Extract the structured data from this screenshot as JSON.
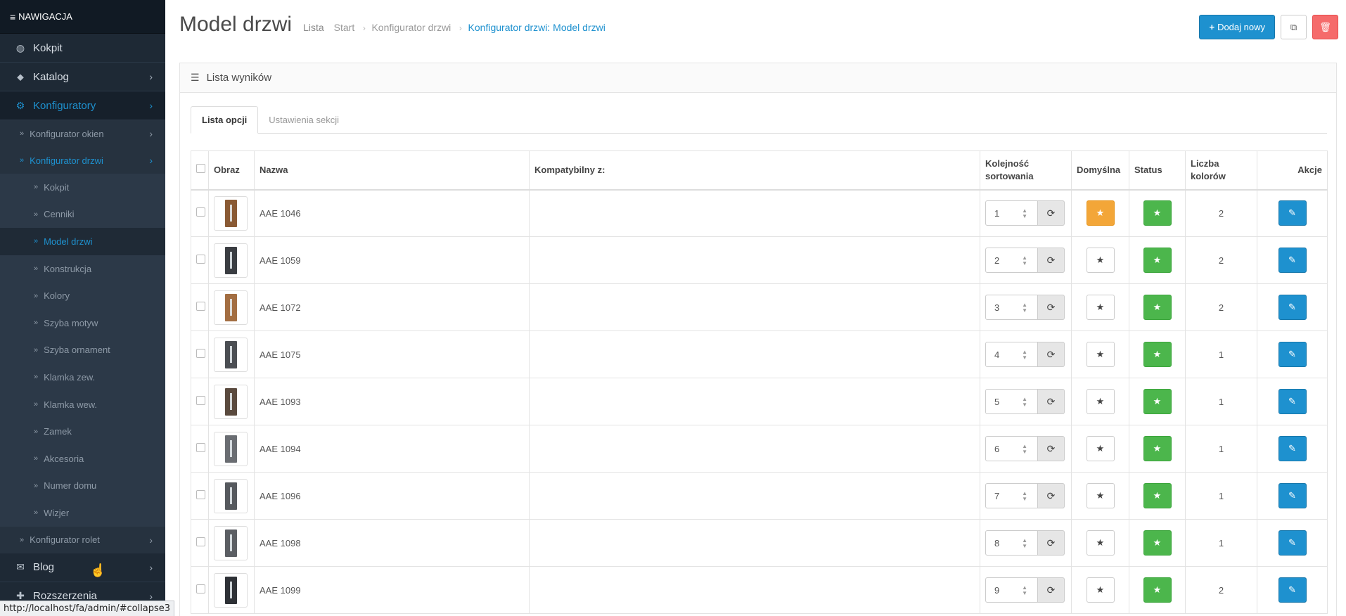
{
  "sidebar": {
    "header": "NAWIGACJA",
    "items": [
      {
        "label": "Kokpit",
        "icon": "dashboard-icon"
      },
      {
        "label": "Katalog",
        "icon": "tags-icon"
      },
      {
        "label": "Konfiguratory",
        "icon": "cogs-icon"
      }
    ],
    "sub_items": [
      {
        "label": "Konfigurator okien"
      },
      {
        "label": "Konfigurator drzwi"
      }
    ],
    "door_items": [
      {
        "label": "Kokpit"
      },
      {
        "label": "Cenniki"
      },
      {
        "label": "Model drzwi"
      },
      {
        "label": "Konstrukcja"
      },
      {
        "label": "Kolory"
      },
      {
        "label": "Szyba motyw"
      },
      {
        "label": "Szyba ornament"
      },
      {
        "label": "Klamka zew."
      },
      {
        "label": "Klamka wew."
      },
      {
        "label": "Zamek"
      },
      {
        "label": "Akcesoria"
      },
      {
        "label": "Numer domu"
      },
      {
        "label": "Wizjer"
      }
    ],
    "rolet": {
      "label": "Konfigurator rolet"
    },
    "blog": {
      "label": "Blog",
      "icon": "comments-icon"
    },
    "ext": {
      "label": "Rozszerzenia",
      "icon": "puzzle-icon"
    }
  },
  "header": {
    "title": "Model drzwi",
    "subtitle": "Lista",
    "breadcrumb": [
      "Start",
      "Konfigurator drzwi",
      "Konfigurator drzwi: Model drzwi"
    ],
    "add_label": "Dodaj nowy"
  },
  "panel": {
    "title": "Lista wyników",
    "tabs": [
      "Lista opcji",
      "Ustawienia sekcji"
    ]
  },
  "table": {
    "columns": {
      "image": "Obraz",
      "name": "Nazwa",
      "compatible": "Kompatybilny z:",
      "sort_1": "Kolejność",
      "sort_2": "sortowania",
      "default": "Domyślna",
      "status": "Status",
      "colors_1": "Liczba",
      "colors_2": "kolorów",
      "actions": "Akcje"
    },
    "rows": [
      {
        "name": "AAE 1046",
        "compatible": "",
        "sort": "1",
        "is_default": true,
        "colors": "2",
        "door_color": "#8a5a34"
      },
      {
        "name": "AAE 1059",
        "compatible": "",
        "sort": "2",
        "is_default": false,
        "colors": "2",
        "door_color": "#3a3d42"
      },
      {
        "name": "AAE 1072",
        "compatible": "",
        "sort": "3",
        "is_default": false,
        "colors": "2",
        "door_color": "#a36e42"
      },
      {
        "name": "AAE 1075",
        "compatible": "",
        "sort": "4",
        "is_default": false,
        "colors": "1",
        "door_color": "#4b4e53"
      },
      {
        "name": "AAE 1093",
        "compatible": "",
        "sort": "5",
        "is_default": false,
        "colors": "1",
        "door_color": "#5a4a3e"
      },
      {
        "name": "AAE 1094",
        "compatible": "",
        "sort": "6",
        "is_default": false,
        "colors": "1",
        "door_color": "#6a6d72"
      },
      {
        "name": "AAE 1096",
        "compatible": "",
        "sort": "7",
        "is_default": false,
        "colors": "1",
        "door_color": "#56595e"
      },
      {
        "name": "AAE 1098",
        "compatible": "",
        "sort": "8",
        "is_default": false,
        "colors": "1",
        "door_color": "#5b5e63"
      },
      {
        "name": "AAE 1099",
        "compatible": "",
        "sort": "9",
        "is_default": false,
        "colors": "2",
        "door_color": "#2e3136"
      }
    ]
  },
  "statusbar": {
    "url": "http://localhost/fa/admin/#collapse3"
  }
}
